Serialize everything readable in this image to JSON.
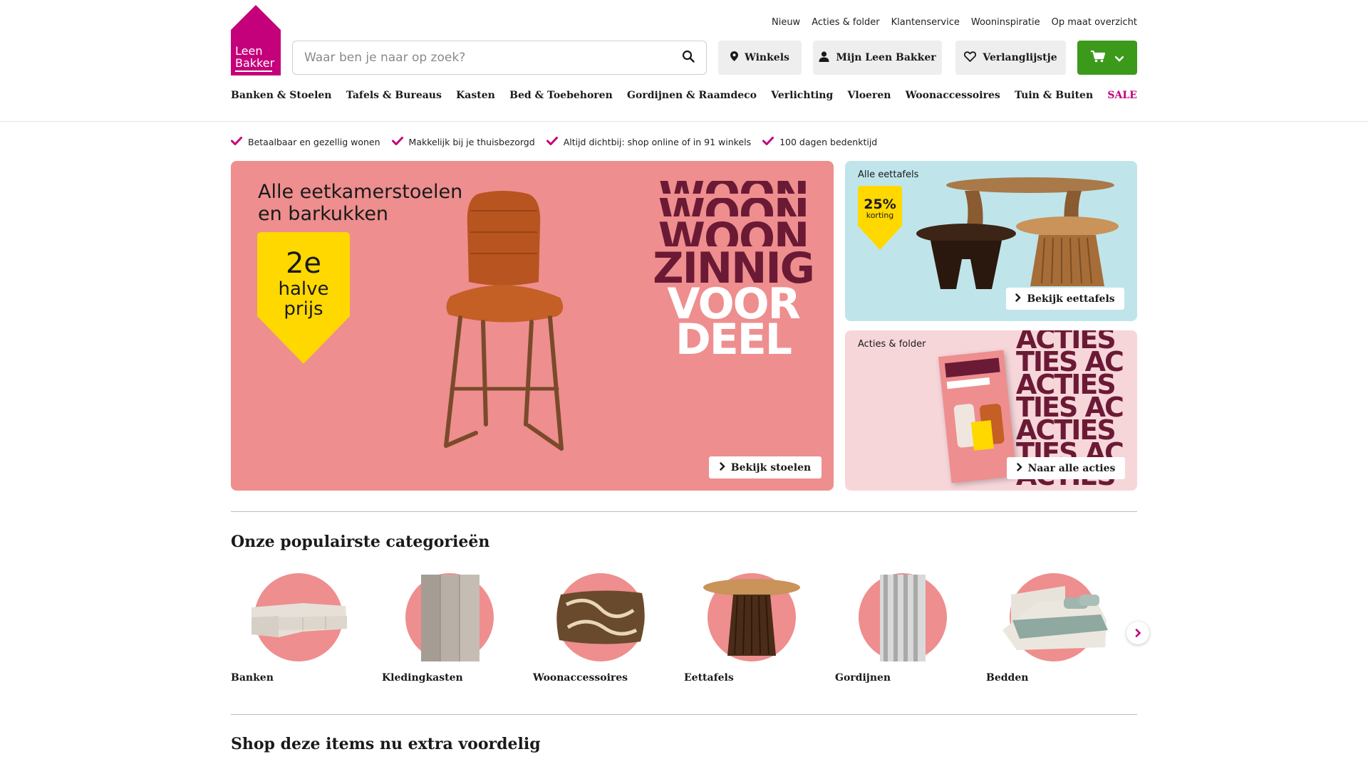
{
  "brand": {
    "logo_line1": "Leen",
    "logo_line2": "Bakker",
    "color": "#c4007a"
  },
  "topnav": [
    "Nieuw",
    "Acties & folder",
    "Klantenservice",
    "Wooninspiratie",
    "Op maat overzicht"
  ],
  "search": {
    "placeholder": "Waar ben je naar op zoek?"
  },
  "header_buttons": {
    "stores": "Winkels",
    "account": "Mijn Leen Bakker",
    "wishlist": "Verlanglijstje"
  },
  "mainnav": [
    "Banken & Stoelen",
    "Tafels & Bureaus",
    "Kasten",
    "Bed & Toebehoren",
    "Gordijnen & Raamdeco",
    "Verlichting",
    "Vloeren",
    "Woonaccessoires",
    "Tuin & Buiten",
    "SALE"
  ],
  "usps": [
    "Betaalbaar en gezellig wonen",
    "Makkelijk bij je thuisbezorgd",
    "Altijd dichtbij: shop online of in 91 winkels",
    "100 dagen bedenktijd"
  ],
  "hero": {
    "title_line1": "Alle eetkamerstoelen",
    "title_line2": "en barkukken",
    "badge_line1": "2e",
    "badge_line2": "halve",
    "badge_line3": "prijs",
    "slogan": [
      "WOON",
      "WOON",
      "WOON",
      "ZINNIG",
      "VOOR",
      "DEEL"
    ],
    "button": "Bekijk stoelen"
  },
  "side1": {
    "label": "Alle eettafels",
    "badge_pct": "25%",
    "badge_text": "korting",
    "button": "Bekijk eettafels"
  },
  "side2": {
    "label": "Acties & folder",
    "slogan": [
      "ACTIES",
      "TIES AC",
      "ACTIES",
      "TIES AC",
      "ACTIES",
      "TIES AC",
      "ACTIES"
    ],
    "button": "Naar alle acties"
  },
  "categories": {
    "heading": "Onze populairste categorieën",
    "items": [
      "Banken",
      "Kledingkasten",
      "Woonaccessoires",
      "Eettafels",
      "Gordijnen",
      "Bedden"
    ]
  },
  "promo": {
    "heading": "Shop deze items nu extra voordelig"
  },
  "colors": {
    "accent": "#c4007a",
    "cart": "#3c9a1b",
    "hero_bg": "#ee8e8e",
    "side1_bg": "#bfe5ea",
    "side2_bg": "#f7d6da",
    "badge": "#ffd800"
  }
}
